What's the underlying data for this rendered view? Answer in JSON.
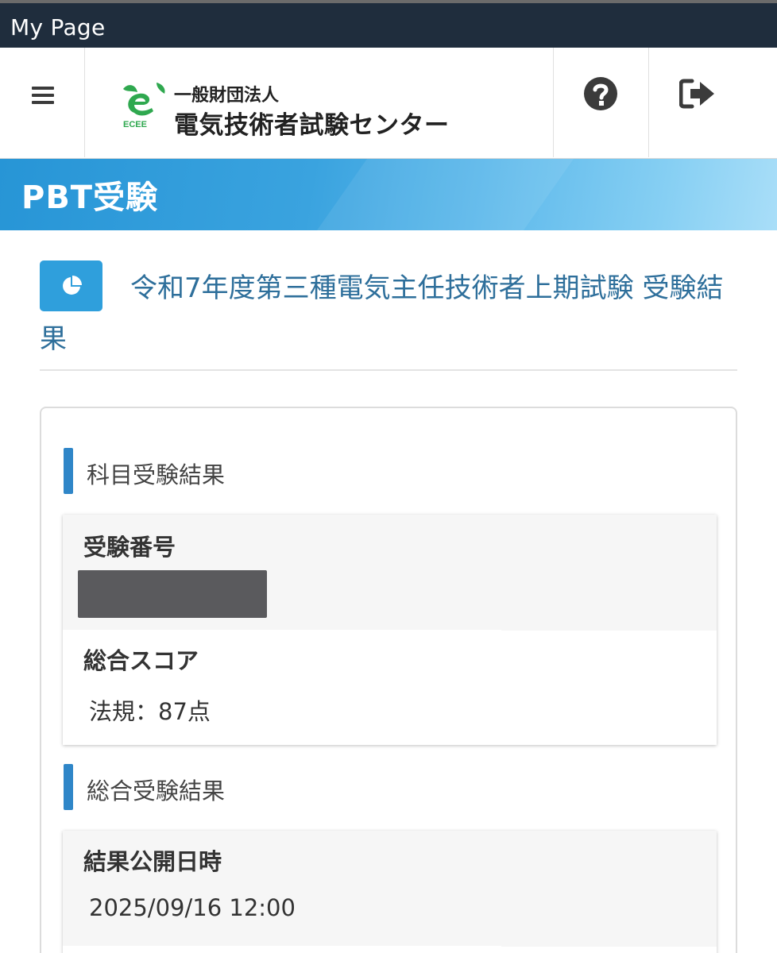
{
  "window": {
    "title": "My Page"
  },
  "header": {
    "org_prefix": "一般財団法人",
    "org_name": "電気技術者試験センター",
    "logo_abbrev": "ECEE"
  },
  "banner": {
    "title": "PBT受験"
  },
  "exam": {
    "title": "令和7年度第三種電気主任技術者上期試験 受験結果"
  },
  "sections": {
    "subject": {
      "heading": "科目受験結果",
      "exam_number_label": "受験番号",
      "score_label": "総合スコア",
      "score_value": "法規：87点"
    },
    "overall": {
      "heading": "総合受験結果",
      "release_label": "結果公開日時",
      "release_value": "2025/09/16 12:00"
    }
  },
  "colors": {
    "titlebar": "#1f2d3d",
    "accent": "#2f9fdc",
    "section_bar": "#2f86c8",
    "title_text": "#2e6f9b"
  }
}
